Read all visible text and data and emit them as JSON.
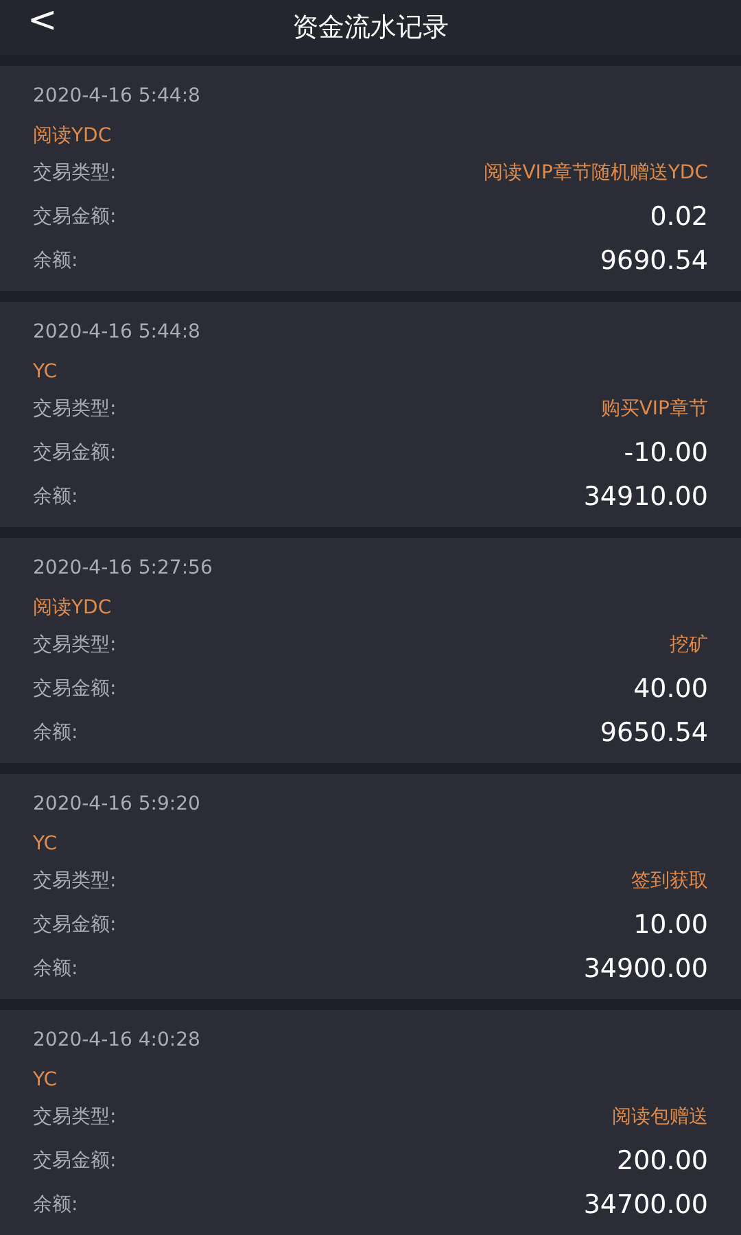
{
  "header": {
    "back": "<",
    "title": "资金流水记录"
  },
  "records": [
    {
      "time": "2020-4-16 5:44:8",
      "currency": "阅读YDC",
      "fields": [
        {
          "label": "交易类型:",
          "value": "阅读VIP章节随机赠送YDC",
          "kind": "type"
        },
        {
          "label": "交易金额:",
          "value": "0.02",
          "kind": "amount"
        },
        {
          "label": "余额:",
          "value": "9690.54",
          "kind": "amount"
        }
      ]
    },
    {
      "time": "2020-4-16 5:44:8",
      "currency": "YC",
      "fields": [
        {
          "label": "交易类型:",
          "value": "购买VIP章节",
          "kind": "type"
        },
        {
          "label": "交易金额:",
          "value": "-10.00",
          "kind": "amount"
        },
        {
          "label": "余额:",
          "value": "34910.00",
          "kind": "amount"
        }
      ]
    },
    {
      "time": "2020-4-16 5:27:56",
      "currency": "阅读YDC",
      "fields": [
        {
          "label": "交易类型:",
          "value": "挖矿",
          "kind": "type"
        },
        {
          "label": "交易金额:",
          "value": "40.00",
          "kind": "amount"
        },
        {
          "label": "余额:",
          "value": "9650.54",
          "kind": "amount"
        }
      ]
    },
    {
      "time": "2020-4-16 5:9:20",
      "currency": "YC",
      "fields": [
        {
          "label": "交易类型:",
          "value": "签到获取",
          "kind": "type"
        },
        {
          "label": "交易金额:",
          "value": "10.00",
          "kind": "amount"
        },
        {
          "label": "余额:",
          "value": "34900.00",
          "kind": "amount"
        }
      ]
    },
    {
      "time": "2020-4-16 4:0:28",
      "currency": "YC",
      "fields": [
        {
          "label": "交易类型:",
          "value": "阅读包赠送",
          "kind": "type"
        },
        {
          "label": "交易金额:",
          "value": "200.00",
          "kind": "amount"
        },
        {
          "label": "余额:",
          "value": "34700.00",
          "kind": "amount"
        }
      ]
    }
  ]
}
